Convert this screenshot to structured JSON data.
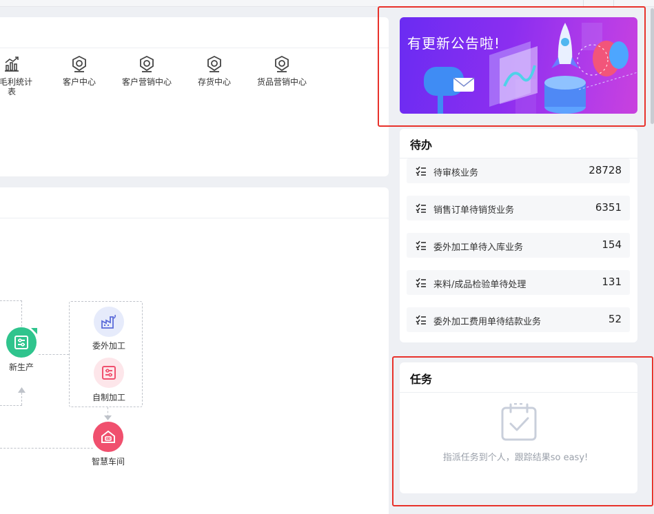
{
  "quick_apps": [
    {
      "label": "营毛利统计\n表",
      "icon": "bar-chart-trend-icon"
    },
    {
      "label": "客户中心",
      "icon": "app-center-icon"
    },
    {
      "label": "客户营销中心",
      "icon": "app-center-icon"
    },
    {
      "label": "存货中心",
      "icon": "app-center-icon"
    },
    {
      "label": "货品营销中心",
      "icon": "app-center-icon"
    }
  ],
  "flow": {
    "new_production": "新生产",
    "outsourced": "委外加工",
    "self_made": "自制加工",
    "smart_workshop": "智慧车间"
  },
  "banner": {
    "title": "有更新公告啦!"
  },
  "todo": {
    "title": "待办",
    "items": [
      {
        "label": "待审核业务",
        "count": "28728"
      },
      {
        "label": "销售订单待销货业务",
        "count": "6351"
      },
      {
        "label": "委外加工单待入库业务",
        "count": "154"
      },
      {
        "label": "来料/成品检验单待处理",
        "count": "131"
      },
      {
        "label": "委外加工费用单待结款业务",
        "count": "52"
      }
    ]
  },
  "task": {
    "title": "任务",
    "empty_text": "指派任务到个人，跟踪结果so easy!"
  },
  "colors": {
    "accent_red": "#e8312a",
    "green_node": "#2fc48d",
    "red_node": "#f0506e",
    "banner_purple": "#8b2ef0"
  }
}
